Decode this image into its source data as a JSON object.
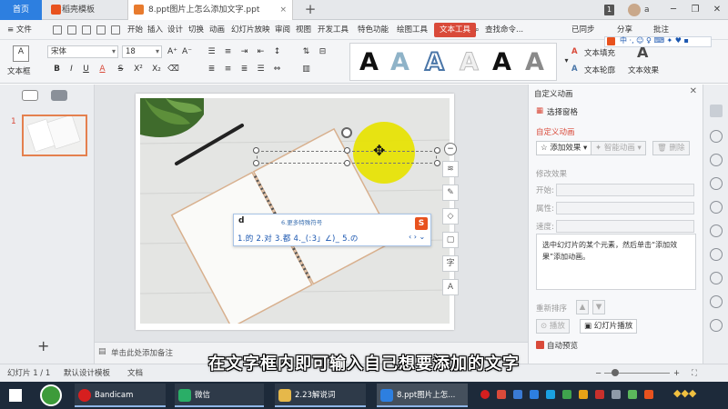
{
  "tabbar": {
    "home": "首页",
    "template_tab": "稻壳模板",
    "doc_tab": "8.ppt图片上怎么添加文字.ppt",
    "badge": "1",
    "user": "a",
    "close": "×",
    "add": "+"
  },
  "menubar": {
    "file": "≡ 文件",
    "items": [
      "开始",
      "插入",
      "设计",
      "切换",
      "动画",
      "幻灯片放映",
      "审阅",
      "视图",
      "开发工具",
      "特色功能",
      "绘图工具"
    ],
    "active": "文本工具",
    "search": "查找命令...",
    "sync": "已同步",
    "share": "分享",
    "comment": "批注"
  },
  "ribbon": {
    "textbox": "文本框",
    "font": "宋体",
    "size": "18",
    "bold": "B",
    "italic": "I",
    "underline": "U",
    "fontcolor": "A",
    "strike": "S",
    "superscript": "X²",
    "subscript": "X₂",
    "art_letters": [
      "A",
      "A",
      "A",
      "A",
      "A",
      "A"
    ],
    "text_fill": "文本填充",
    "text_outline": "文本轮廓",
    "text_effect": "文本效果"
  },
  "leftpane": {
    "thumb_number": "1",
    "add": "+"
  },
  "canvas": {
    "notes_placeholder": "单击此处添加备注",
    "ime": {
      "input": "d",
      "hint": "6.更多特殊符号",
      "candidates": "1.的  2.对  3.都  4._(:3」∠)_  5.の",
      "logo": "S"
    },
    "tools": [
      "≋",
      "✎",
      "◇",
      "▢",
      "字",
      "A"
    ]
  },
  "rightpane": {
    "title": "自定义动画",
    "select_pane": "选择窗格",
    "custom_anim": "自定义动画",
    "add_effect": "添加效果",
    "smart_anim": "智能动画",
    "delete": "删除",
    "modify_effect": "修改效果",
    "start": "开始:",
    "property": "属性:",
    "speed": "速度:",
    "description": "选中幻灯片的某个元素，然后单击“添加效果”添加动画。",
    "reorder": "重新排序",
    "play": "播放",
    "slideshow": "幻灯片播放",
    "autopreview": "自动预览"
  },
  "statusbar": {
    "slide_counter": "幻灯片 1 / 1",
    "design_template": "默认设计模板",
    "doc_protect": "文档"
  },
  "subtitle": "在文字框内即可输入自己想要添加的文字",
  "taskbar": {
    "bandicam": "Bandicam",
    "wechat": "微信",
    "folder": "2.23解说词",
    "wps": "8.ppt图片上怎..."
  },
  "colors": {
    "accent": "#d94a3a",
    "home_tab": "#2d7fe0",
    "highlight_circle": "#e7e300",
    "taskbar": "#1d2a3a"
  }
}
